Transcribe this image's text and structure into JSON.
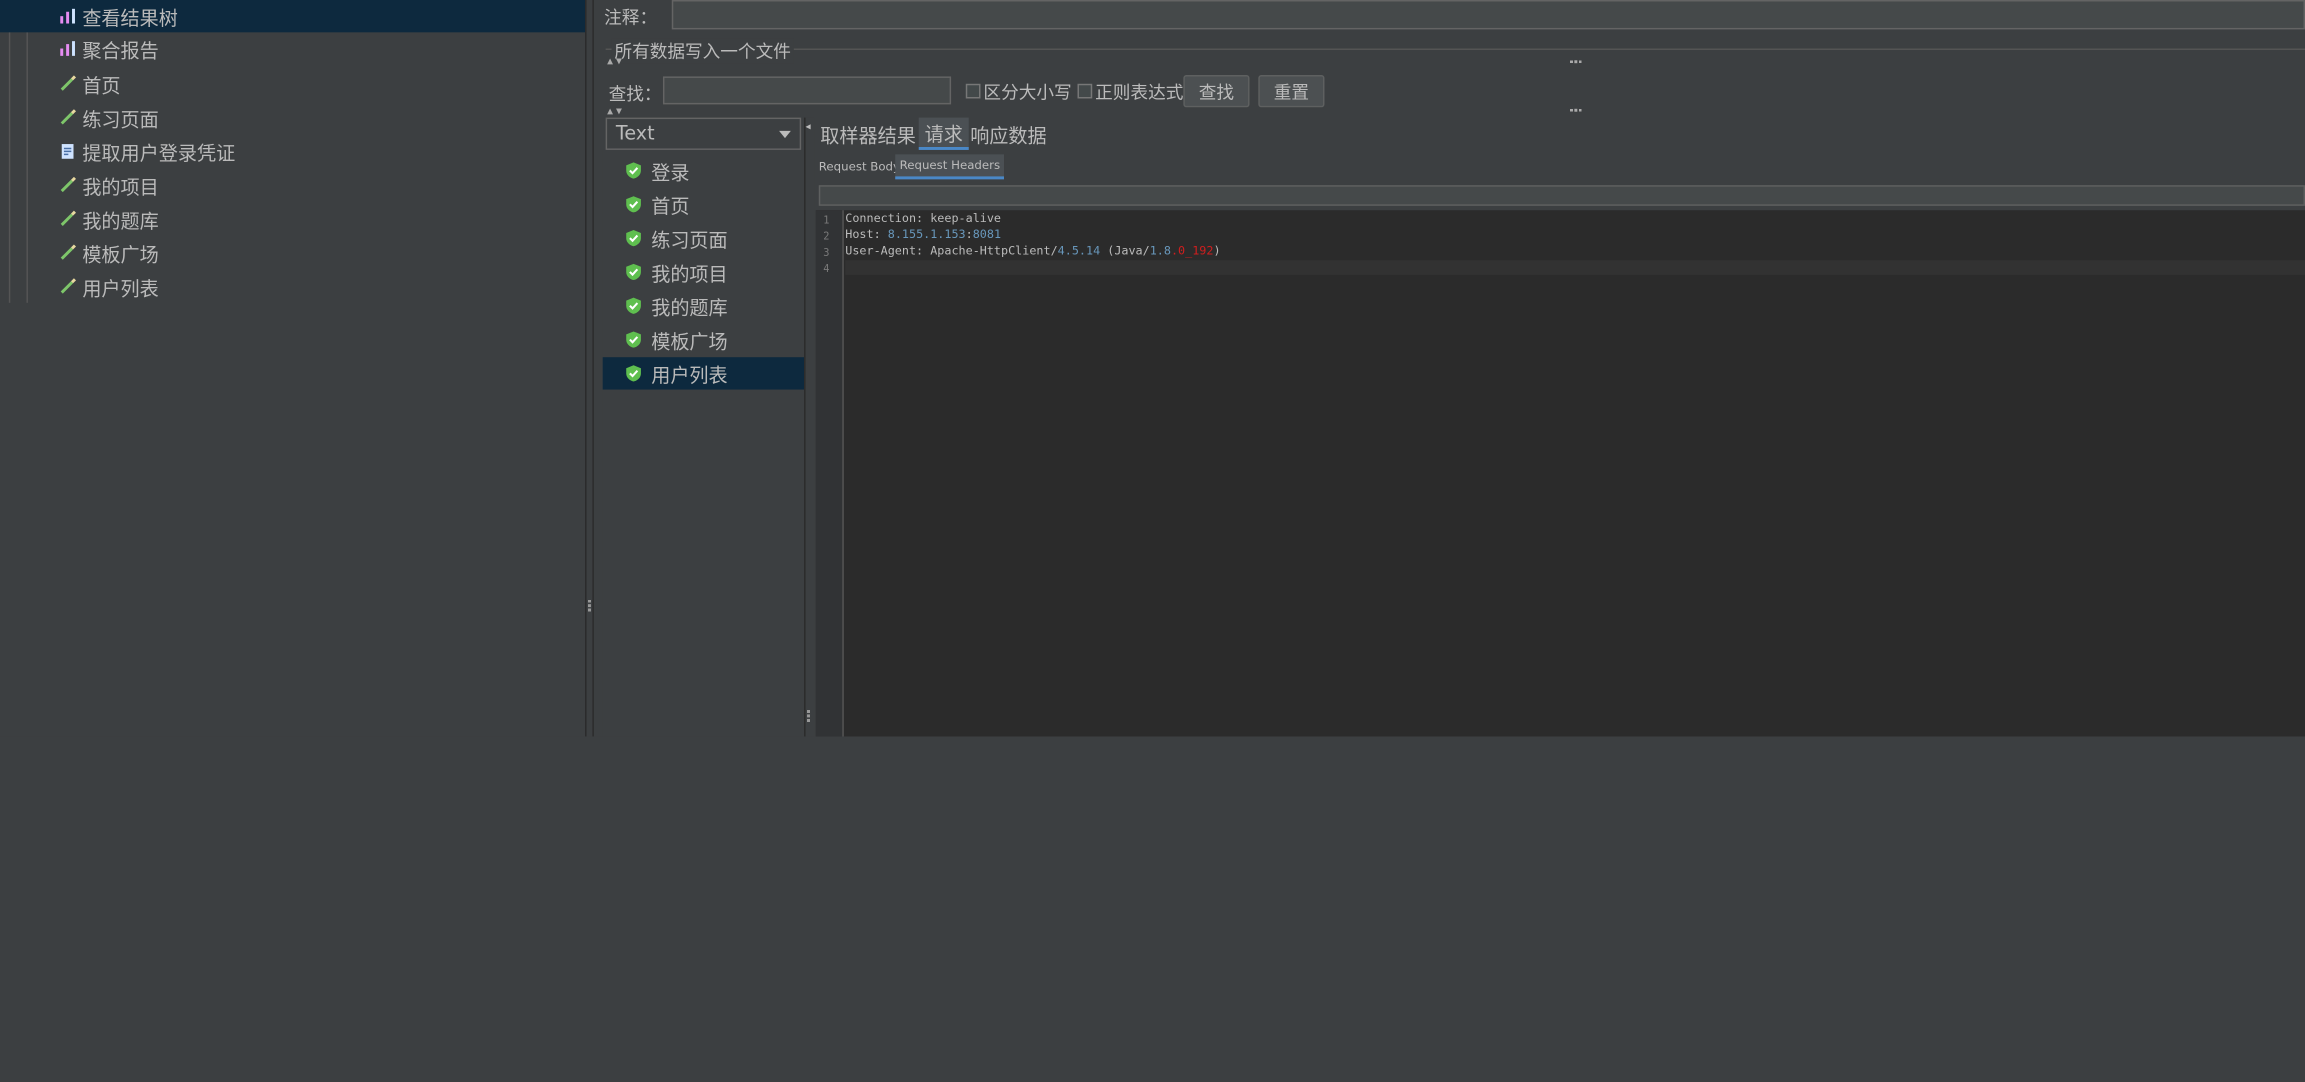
{
  "tree": {
    "items": [
      {
        "label": "查看结果树",
        "icon": "result-tree-icon",
        "color": "#e58cf2",
        "selected": true
      },
      {
        "label": "聚合报告",
        "icon": "aggregate-report-icon",
        "color": "#e58cf2"
      },
      {
        "label": "首页",
        "icon": "http-sampler-icon",
        "color": "#7ec66a"
      },
      {
        "label": "练习页面",
        "icon": "http-sampler-icon",
        "color": "#7ec66a"
      },
      {
        "label": "提取用户登录凭证",
        "icon": "script-icon",
        "color": "#cfe3ff"
      },
      {
        "label": "我的项目",
        "icon": "http-sampler-icon",
        "color": "#7ec66a"
      },
      {
        "label": "我的题库",
        "icon": "http-sampler-icon",
        "color": "#7ec66a"
      },
      {
        "label": "模板广场",
        "icon": "http-sampler-icon",
        "color": "#7ec66a"
      },
      {
        "label": "用户列表",
        "icon": "http-sampler-icon",
        "color": "#7ec66a"
      }
    ]
  },
  "form": {
    "comment_label": "注释：",
    "write_all_label": "所有数据写入一个文件",
    "search_label": "查找：",
    "search_value": "",
    "case_sensitive_label": "区分大小写",
    "regex_label": "正则表达式",
    "find_button": "查找",
    "reset_button": "重置"
  },
  "renderer": {
    "selected": "Text"
  },
  "samples": {
    "items": [
      {
        "label": "登录"
      },
      {
        "label": "首页"
      },
      {
        "label": "练习页面"
      },
      {
        "label": "我的项目"
      },
      {
        "label": "我的题库"
      },
      {
        "label": "模板广场"
      },
      {
        "label": "用户列表",
        "selected": true
      }
    ]
  },
  "tabs": {
    "sampler_result": "取样器结果",
    "request": "请求",
    "response_data": "响应数据"
  },
  "subtabs": {
    "request_body": "Request Body",
    "request_headers": "Request Headers"
  },
  "editor": {
    "line_numbers": [
      "1",
      "2",
      "3",
      "4"
    ],
    "lines": [
      {
        "parts": [
          {
            "t": "Connection: keep-alive",
            "c": "#bbbbbb"
          }
        ]
      },
      {
        "parts": [
          {
            "t": "Host: ",
            "c": "#bbbbbb"
          },
          {
            "t": "8.155.1.153",
            "c": "#6897bb"
          },
          {
            "t": ":",
            "c": "#bbbbbb"
          },
          {
            "t": "8081",
            "c": "#6897bb"
          }
        ]
      },
      {
        "parts": [
          {
            "t": "User-Agent: Apache-HttpClient/",
            "c": "#bbbbbb"
          },
          {
            "t": "4.5.14",
            "c": "#6897bb"
          },
          {
            "t": " (Java/",
            "c": "#bbbbbb"
          },
          {
            "t": "1.8",
            "c": "#6897bb"
          },
          {
            "t": ".0_192",
            "c": "#d11e1e"
          },
          {
            "t": ")",
            "c": "#bbbbbb"
          }
        ]
      },
      {
        "parts": []
      }
    ]
  },
  "colors": {
    "accent": "#4a88c7",
    "selection": "#0d293e",
    "background": "#3c3f41",
    "editor_bg": "#2b2b2b"
  }
}
